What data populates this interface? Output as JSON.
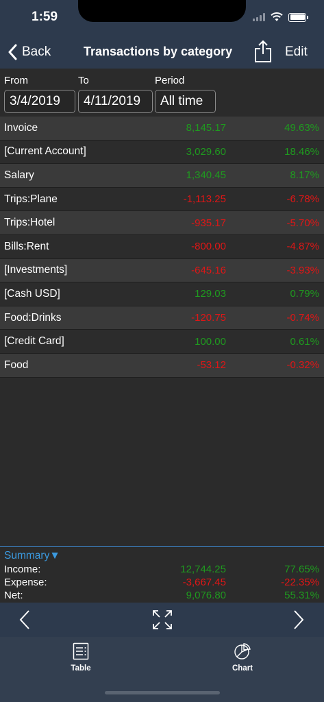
{
  "status": {
    "time": "1:59"
  },
  "nav": {
    "back_label": "Back",
    "title": "Transactions by category",
    "edit_label": "Edit"
  },
  "filters": {
    "from_label": "From",
    "from_value": "3/4/2019",
    "to_label": "To",
    "to_value": "4/11/2019",
    "period_label": "Period",
    "period_value": "All time"
  },
  "rows": [
    {
      "name": "Invoice",
      "amount": "8,145.17",
      "percent": "49.63%",
      "sign": "pos"
    },
    {
      "name": "[Current Account]",
      "amount": "3,029.60",
      "percent": "18.46%",
      "sign": "pos"
    },
    {
      "name": "Salary",
      "amount": "1,340.45",
      "percent": "8.17%",
      "sign": "pos"
    },
    {
      "name": "Trips:Plane",
      "amount": "-1,113.25",
      "percent": "-6.78%",
      "sign": "neg"
    },
    {
      "name": "Trips:Hotel",
      "amount": "-935.17",
      "percent": "-5.70%",
      "sign": "neg"
    },
    {
      "name": "Bills:Rent",
      "amount": "-800.00",
      "percent": "-4.87%",
      "sign": "neg"
    },
    {
      "name": "[Investments]",
      "amount": "-645.16",
      "percent": "-3.93%",
      "sign": "neg"
    },
    {
      "name": "[Cash USD]",
      "amount": "129.03",
      "percent": "0.79%",
      "sign": "pos"
    },
    {
      "name": "Food:Drinks",
      "amount": "-120.75",
      "percent": "-0.74%",
      "sign": "neg"
    },
    {
      "name": "[Credit Card]",
      "amount": "100.00",
      "percent": "0.61%",
      "sign": "pos"
    },
    {
      "name": "Food",
      "amount": "-53.12",
      "percent": "-0.32%",
      "sign": "neg"
    }
  ],
  "summary": {
    "header": "Summary",
    "income_label": "Income:",
    "income_amount": "12,744.25",
    "income_percent": "77.65%",
    "expense_label": "Expense:",
    "expense_amount": "-3,667.45",
    "expense_percent": "-22.35%",
    "net_label": "Net:",
    "net_amount": "9,076.80",
    "net_percent": "55.31%"
  },
  "tabs": [
    {
      "label": "Table",
      "icon": "list-icon"
    },
    {
      "label": "Chart",
      "icon": "pie-chart-icon"
    }
  ],
  "colors": {
    "positive": "#1f9a1f",
    "negative": "#e01616",
    "bar": "#2d3a4d",
    "accent": "#3b9ae0"
  }
}
